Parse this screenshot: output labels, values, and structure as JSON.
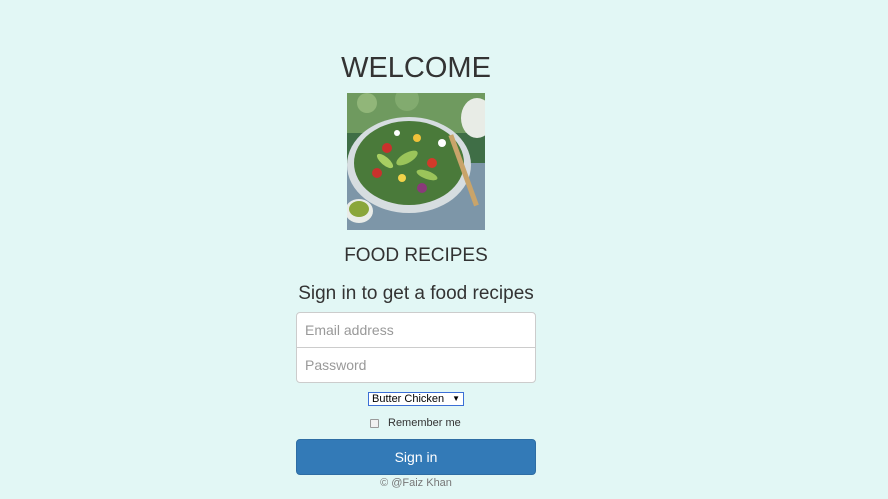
{
  "header": {
    "welcome": "WELCOME",
    "brand": "FOOD RECIPES",
    "subtitle": "Sign in to get a food recipes"
  },
  "form": {
    "email_placeholder": "Email address",
    "password_placeholder": "Password",
    "recipe_selected": "Butter Chicken",
    "remember_label": "Remember me",
    "submit_label": "Sign in"
  },
  "footer": {
    "copyright": "© @Faiz Khan"
  },
  "colors": {
    "background": "#e2f7f5",
    "primary": "#337ab7"
  },
  "icons": {
    "dropdown": "triangle-down-icon"
  }
}
